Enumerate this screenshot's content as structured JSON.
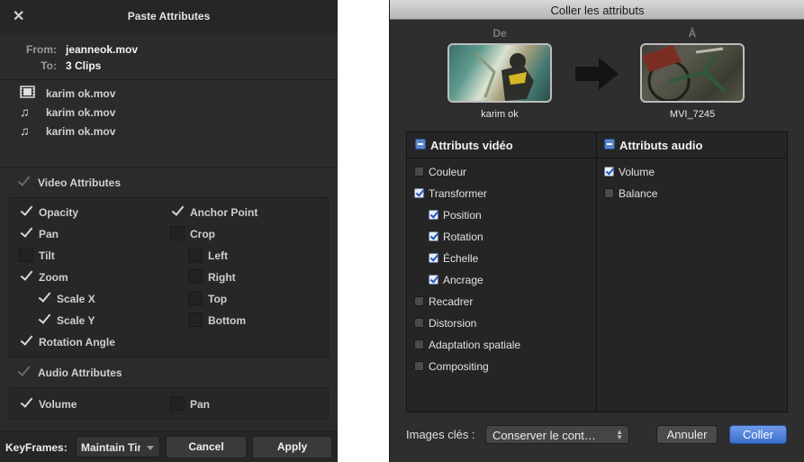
{
  "left_dialog": {
    "title": "Paste Attributes",
    "from_label": "From:",
    "from_value": "jeanneok.mov",
    "to_label": "To:",
    "to_value": "3 Clips",
    "clips": [
      {
        "icon": "film-icon",
        "name": "karim ok.mov"
      },
      {
        "icon": "music-note-icon",
        "name": "karim ok.mov"
      },
      {
        "icon": "music-note-icon",
        "name": "karim ok.mov"
      }
    ],
    "video_section": {
      "label": "Video Attributes",
      "checked": true,
      "items": {
        "opacity": {
          "label": "Opacity",
          "checked": true
        },
        "pan": {
          "label": "Pan",
          "checked": true
        },
        "tilt": {
          "label": "Tilt",
          "checked": false
        },
        "zoom": {
          "label": "Zoom",
          "checked": true
        },
        "scale_x": {
          "label": "Scale X",
          "checked": true
        },
        "scale_y": {
          "label": "Scale Y",
          "checked": true
        },
        "rotation_angle": {
          "label": "Rotation Angle",
          "checked": true
        },
        "anchor_point": {
          "label": "Anchor Point",
          "checked": true
        },
        "crop": {
          "label": "Crop",
          "checked": false
        },
        "left": {
          "label": "Left",
          "checked": false
        },
        "right": {
          "label": "Right",
          "checked": false
        },
        "top": {
          "label": "Top",
          "checked": false
        },
        "bottom": {
          "label": "Bottom",
          "checked": false
        }
      }
    },
    "audio_section": {
      "label": "Audio Attributes",
      "checked": true,
      "items": {
        "volume": {
          "label": "Volume",
          "checked": true
        },
        "pan": {
          "label": "Pan",
          "checked": false
        }
      }
    },
    "keyframes_label": "KeyFrames:",
    "keyframes_value": "Maintain Timing",
    "cancel_label": "Cancel",
    "apply_label": "Apply"
  },
  "right_dialog": {
    "title": "Coller les attributs",
    "source_header": "De",
    "dest_header": "À",
    "source_caption": "karim ok",
    "dest_caption": "MVI_7245",
    "video_header": "Attributs vidéo",
    "audio_header": "Attributs audio",
    "video_items": [
      {
        "label": "Couleur",
        "checked": false
      },
      {
        "label": "Transformer",
        "checked": true
      },
      {
        "label": "Position",
        "checked": true,
        "indent": true
      },
      {
        "label": "Rotation",
        "checked": true,
        "indent": true
      },
      {
        "label": "Échelle",
        "checked": true,
        "indent": true
      },
      {
        "label": "Ancrage",
        "checked": true,
        "indent": true
      },
      {
        "label": "Recadrer",
        "checked": false
      },
      {
        "label": "Distorsion",
        "checked": false
      },
      {
        "label": "Adaptation spatiale",
        "checked": false
      },
      {
        "label": "Compositing",
        "checked": false
      }
    ],
    "audio_items": [
      {
        "label": "Volume",
        "checked": true
      },
      {
        "label": "Balance",
        "checked": false
      }
    ],
    "keyframes_label": "Images clés :",
    "keyframes_value": "Conserver le cont…",
    "cancel_label": "Annuler",
    "ok_label": "Coller",
    "accent_color": "#3d6fcf"
  }
}
